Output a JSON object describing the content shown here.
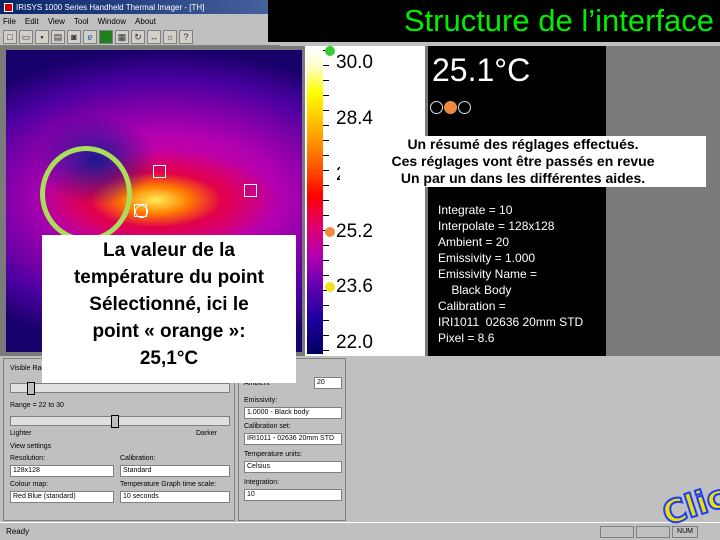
{
  "window": {
    "title": "IRISYS 1000 Series Handheld Thermal Imager - [TH]"
  },
  "menu": [
    "File",
    "Edit",
    "View",
    "Tool",
    "Window",
    "About"
  ],
  "toolbar_icons": [
    "new-icon",
    "open-icon",
    "save-icon",
    "print-icon",
    "camera-icon",
    "e-icon",
    "image-icon",
    "grid-icon",
    "rotate-icon",
    "arrow-icon",
    "sun-icon",
    "help-icon"
  ],
  "slide": {
    "title": "Structure de l’interface"
  },
  "scale": {
    "max": "30.0",
    "v2": "28.4",
    "v3": "2",
    "v4": "25.2",
    "v5": "23.6",
    "min": "22.0"
  },
  "readout": {
    "value": "25.1°C"
  },
  "summary": {
    "line1": "Un résumé des réglages effectués.",
    "line2": "Ces  réglages vont être passés en revue",
    "line3": "Un par un dans les différentes aides."
  },
  "settings": {
    "integrate": "Integrate = 10",
    "interpolate": "Interpolate = 128x128",
    "ambient": "Ambient = 20",
    "emissivity": "Emissivity = 1.000",
    "emissivity_name": "Emissivity Name =",
    "emissivity_name_value": "    Black Body",
    "calibration": "Calibration =",
    "calibration_value": "IRI1011  02636 20mm STD",
    "pixel": "Pixel = 8.6"
  },
  "callout": {
    "line1": "La valeur de la",
    "line2": "température du point",
    "line3": "Sélectionné, ici le",
    "line4": "point « orange »:",
    "line5": "25,1°C"
  },
  "controls": {
    "visible_range": "Visible Range",
    "range": "Range = 22 to 30",
    "lighter": "Lighter",
    "darker": "Darker",
    "view_settings": "View settings",
    "resolution_label": "Resolution:",
    "resolution": "128x128",
    "calibration_label": "Calibration:",
    "calibration": "Standard",
    "colour_map_label": "Colour map:",
    "colour_map": "Red Blue (standard)",
    "temp_graph_label": "Temperature Graph time scale:",
    "temp_graph": "10 seconds",
    "ambient_label": "Ambient",
    "ambient_value": "20",
    "emissivity_label": "Emissivity:",
    "emissivity_value": "1.0000 - Black body",
    "calibration_set_label": "Calibration set:",
    "calibration_set": "IRI1011 - 02636 20mm STD",
    "temperature_units_label": "Temperature units:",
    "temperature_units": "Celsius",
    "integration_label": "Integration:",
    "integration": "10"
  },
  "status": {
    "text": "Ready",
    "num": "NUM"
  },
  "logo": {
    "text": "Clic"
  }
}
